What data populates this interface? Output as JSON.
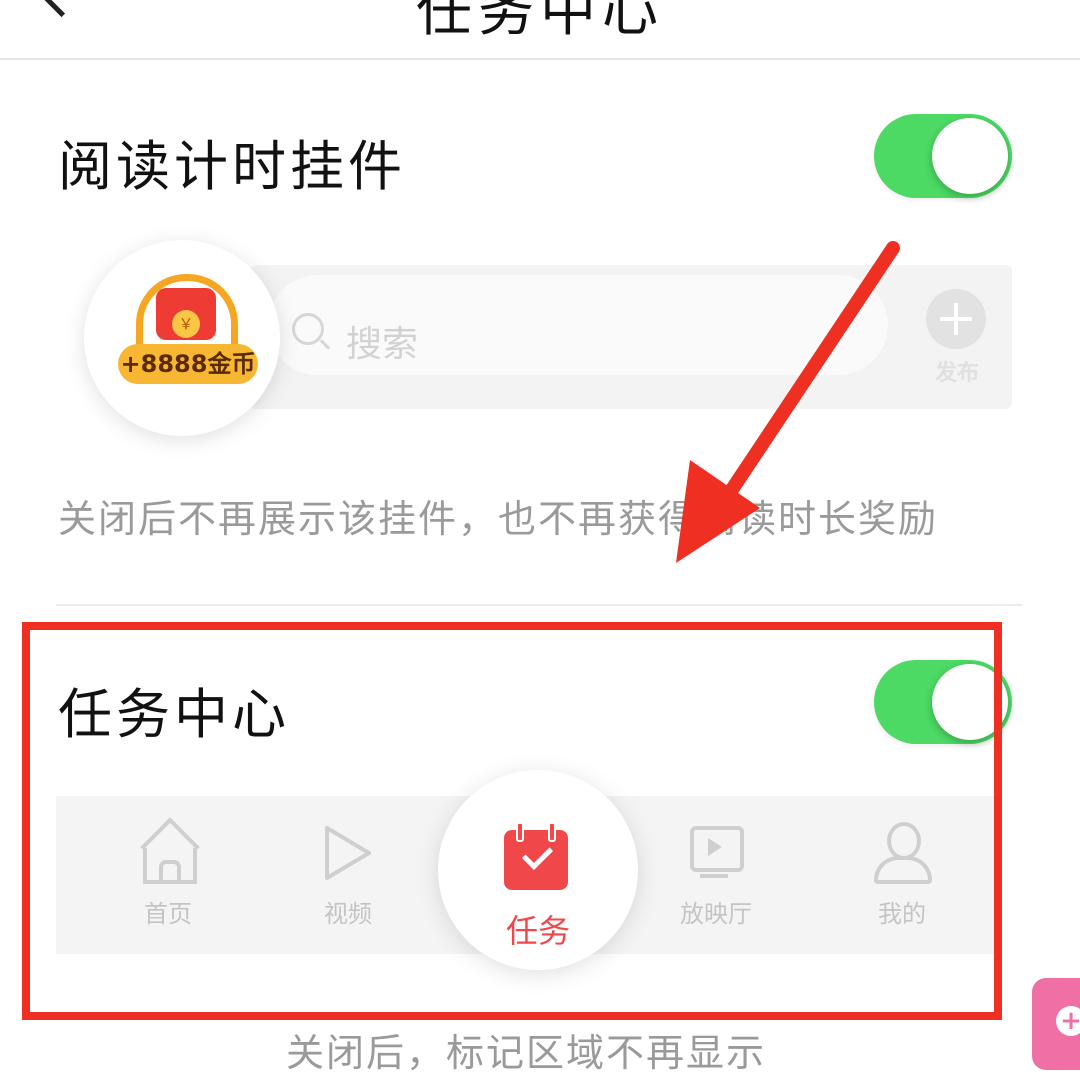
{
  "header": {
    "title": "任务中心"
  },
  "reading_widget": {
    "title": "阅读计时挂件",
    "enabled": true,
    "preview": {
      "coin_badge": "+8888金币",
      "coin_symbol": "￥",
      "search_placeholder": "搜索",
      "post_label": "发布"
    },
    "description": "关闭后不再展示该挂件，也不再获得阅读时长奖励"
  },
  "task_center": {
    "title": "任务中心",
    "enabled": true,
    "tabbar": {
      "home": "首页",
      "video": "视频",
      "task": "任务",
      "cinema": "放映厅",
      "mine": "我的"
    },
    "description": "关闭后，标记区域不再显示"
  },
  "colors": {
    "toggle_on": "#4cd964",
    "annotation_red": "#ee2f22",
    "task_red": "#f0474b",
    "float_pink": "#f06fa4"
  }
}
